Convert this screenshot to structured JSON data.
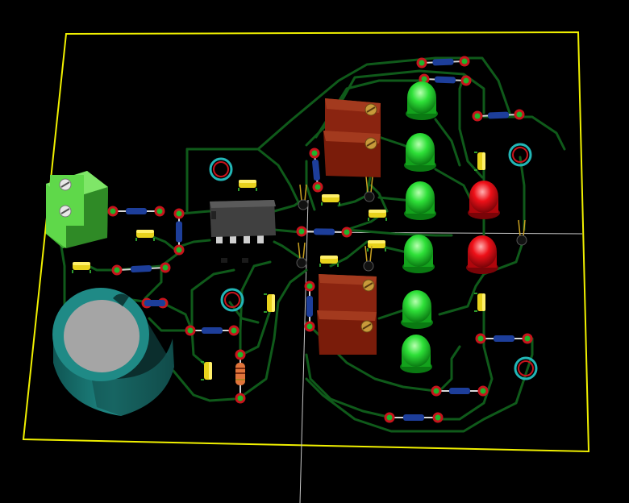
{
  "colors": {
    "background": "#000000",
    "board_outline": "#f0f000",
    "trace": "#0f5a1a",
    "pad_red": "#c8141c",
    "pad_green": "#1fb52b",
    "resistor_blue": "#1d3e9a",
    "capacitor_yellow": "#e8d21c",
    "led_green": "#22d42c",
    "led_red": "#e00a14",
    "trimmer_body": "#7a1c0a",
    "trimmer_screw": "#c89a3a",
    "terminal_block": "#5fd84a",
    "electrolytic_body": "#1f8a86",
    "electrolytic_top": "#a5a5a5",
    "ic_body": "#3a3a3a",
    "mount_hole_ring": "#22b6b6",
    "crosshair": "#c8c8c8"
  },
  "components": {
    "leds_green_count": 6,
    "leds_red_count": 2,
    "trimmers_count": 4,
    "ic_count": 1,
    "terminal_block_count": 1,
    "electrolytic_cap_count": 1,
    "mount_holes_count": 4
  },
  "icons": [
    "pcb-board-icon",
    "ic-chip-icon",
    "led-icon",
    "trimmer-icon",
    "terminal-block-icon",
    "capacitor-icon"
  ]
}
